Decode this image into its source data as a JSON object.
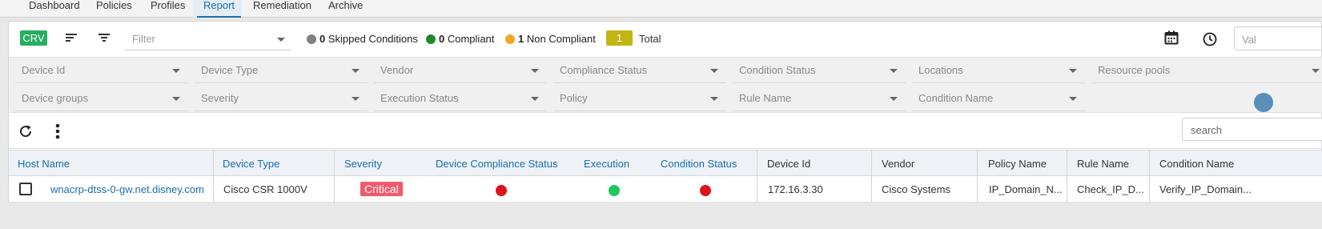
{
  "nav": {
    "tabs": [
      {
        "label": "Dashboard"
      },
      {
        "label": "Policies"
      },
      {
        "label": "Profiles"
      },
      {
        "label": "Report"
      },
      {
        "label": "Remediation"
      },
      {
        "label": "Archive"
      }
    ],
    "active": "Report"
  },
  "toolbar": {
    "crv_label": "CRV",
    "filter_placeholder": "Filter",
    "legend": [
      {
        "count": "0",
        "label": "Skipped Conditions",
        "color": "#808080"
      },
      {
        "count": "0",
        "label": "Compliant",
        "color": "#1e8a2c"
      },
      {
        "count": "1",
        "label": "Non Compliant",
        "color": "#f5a623"
      }
    ],
    "total_count": "1",
    "total_label": "Total",
    "val_placeholder": "Val"
  },
  "filters": {
    "row1": [
      "Device Id",
      "Device Type",
      "Vendor",
      "Compliance Status",
      "Condition Status",
      "Locations",
      "Resource pools"
    ],
    "row2": [
      "Device groups",
      "Severity",
      "Execution Status",
      "Policy",
      "Rule Name",
      "Condition Name"
    ]
  },
  "search": {
    "placeholder": "search"
  },
  "table": {
    "columns": [
      "Host Name",
      "Device Type",
      "Severity",
      "Device Compliance Status",
      "Execution",
      "Condition Status",
      "Device Id",
      "Vendor",
      "Policy Name",
      "Rule Name",
      "Condition Name"
    ],
    "rows": [
      {
        "host_name": "wnacrp-dtss-0-gw.net.disney.com",
        "device_type": "Cisco CSR 1000V",
        "severity": "Critical",
        "compliance_color": "#e0121b",
        "execution_color": "#22c55e",
        "condition_color": "#e0121b",
        "device_id": "172.16.3.30",
        "vendor": "Cisco Systems",
        "policy_name": "IP_Domain_N...",
        "rule_name": "Check_IP_D...",
        "condition_name": "Verify_IP_Domain..."
      }
    ]
  }
}
